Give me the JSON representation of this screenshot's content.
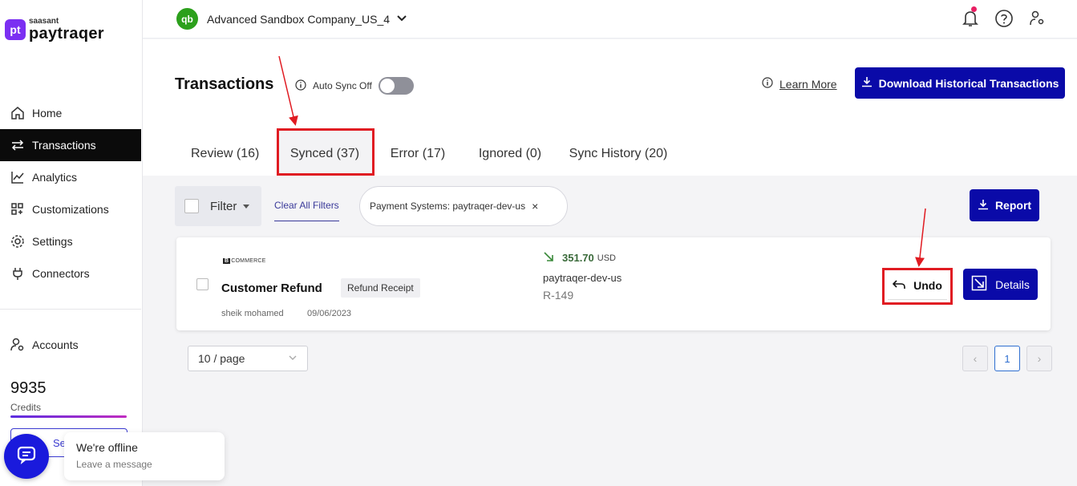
{
  "brand": {
    "mark": "pt",
    "top": "saasant",
    "name": "paytraqer"
  },
  "sidebar": {
    "items": [
      {
        "label": "Home",
        "icon": "home-icon"
      },
      {
        "label": "Transactions",
        "icon": "arrows-icon"
      },
      {
        "label": "Analytics",
        "icon": "chart-icon"
      },
      {
        "label": "Customizations",
        "icon": "grid-icon"
      },
      {
        "label": "Settings",
        "icon": "gear-icon"
      },
      {
        "label": "Connectors",
        "icon": "plug-icon"
      }
    ],
    "accounts_label": "Accounts",
    "credits_value": "9935",
    "credits_label": "Credits",
    "bottom_button_partial": "Se"
  },
  "chat": {
    "title": "We're offline",
    "subtitle": "Leave a message"
  },
  "header": {
    "logo": "qb",
    "company": "Advanced Sandbox Company_US_4"
  },
  "page": {
    "title": "Transactions",
    "autosync_label": "Auto Sync Off",
    "learn_more": "Learn More",
    "download_button": "Download Historical Transactions"
  },
  "tabs": [
    {
      "label": "Review (16)"
    },
    {
      "label": "Synced (37)"
    },
    {
      "label": "Error (17)"
    },
    {
      "label": "Ignored (0)"
    },
    {
      "label": "Sync History (20)"
    }
  ],
  "filter": {
    "label": "Filter",
    "clear_all": "Clear All Filters",
    "chip": "Payment Systems: paytraqer-dev-us",
    "chip_close": "×",
    "report_button": "Report"
  },
  "transaction": {
    "logo_text": "COMMERCE",
    "title": "Customer Refund",
    "badge": "Refund Receipt",
    "user": "sheik mohamed",
    "date": "09/06/2023",
    "amount": "351.70",
    "currency": "USD",
    "payment_system": "paytraqer-dev-us",
    "ref": "R-149",
    "undo_button": "Undo",
    "details_button": "Details"
  },
  "pagination": {
    "per_page": "10 / page",
    "current_page": "1",
    "prev": "‹",
    "next": "›"
  },
  "colors": {
    "primary_button": "#0a0aa8",
    "annotation_red": "#e01b22",
    "qb_green": "#2ca01c",
    "brand_purple": "#7b2ff2"
  }
}
